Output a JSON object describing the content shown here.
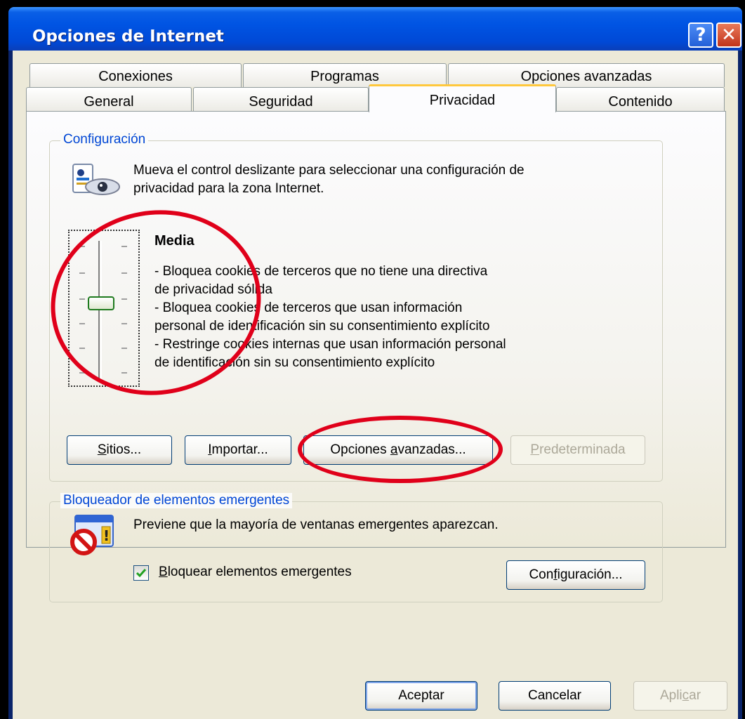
{
  "window": {
    "title": "Opciones de Internet",
    "help_glyph": "?",
    "close_glyph": "✕"
  },
  "tabs": {
    "row_back": [
      "Conexiones",
      "Programas",
      "Opciones avanzadas"
    ],
    "row_front": [
      "General",
      "Seguridad",
      "Privacidad",
      "Contenido"
    ],
    "active": "Privacidad"
  },
  "config": {
    "legend": "Configuración",
    "desc_line1": "Mueva el control deslizante para seleccionar una configuración de",
    "desc_line2": "privacidad para la zona Internet.",
    "level": "Media",
    "level_position": 0.5,
    "details": [
      "- Bloquea cookies de terceros que no tiene una directiva",
      "de privacidad sólida",
      "- Bloquea cookies de terceros que usan información",
      "personal de identificación sin su consentimiento explícito",
      "- Restringe cookies internas que usan información personal",
      "de identificación sin su consentimiento explícito"
    ],
    "buttons": {
      "sitios_u": "S",
      "sitios_rest": "itios...",
      "importar_u": "I",
      "importar_rest": "mportar...",
      "avanzadas_pre": "Opciones ",
      "avanzadas_u": "a",
      "avanzadas_rest": "vanzadas...",
      "predeterminada_u": "P",
      "predeterminada_rest": "redeterminada"
    }
  },
  "popup": {
    "legend": "Bloqueador de elementos emergentes",
    "desc": "Previene que la mayoría de ventanas emergentes aparezcan.",
    "checkbox_checked": true,
    "checkbox_u": "B",
    "checkbox_rest": "loquear elementos emergentes",
    "config_pre": "Con",
    "config_u": "f",
    "config_rest": "iguración..."
  },
  "footer": {
    "aceptar": "Aceptar",
    "cancelar": "Cancelar",
    "aplicar_pre": "Apli",
    "aplicar_u": "c",
    "aplicar_rest": "ar"
  },
  "colors": {
    "titlebar": "#0054e3",
    "legend": "#0046d5",
    "annotation": "#e0001a",
    "tab_highlight": "#ffc83c"
  },
  "icons": [
    "privacy-eye-icon",
    "popup-blocker-icon",
    "help-icon",
    "close-icon",
    "checkmark-icon"
  ]
}
